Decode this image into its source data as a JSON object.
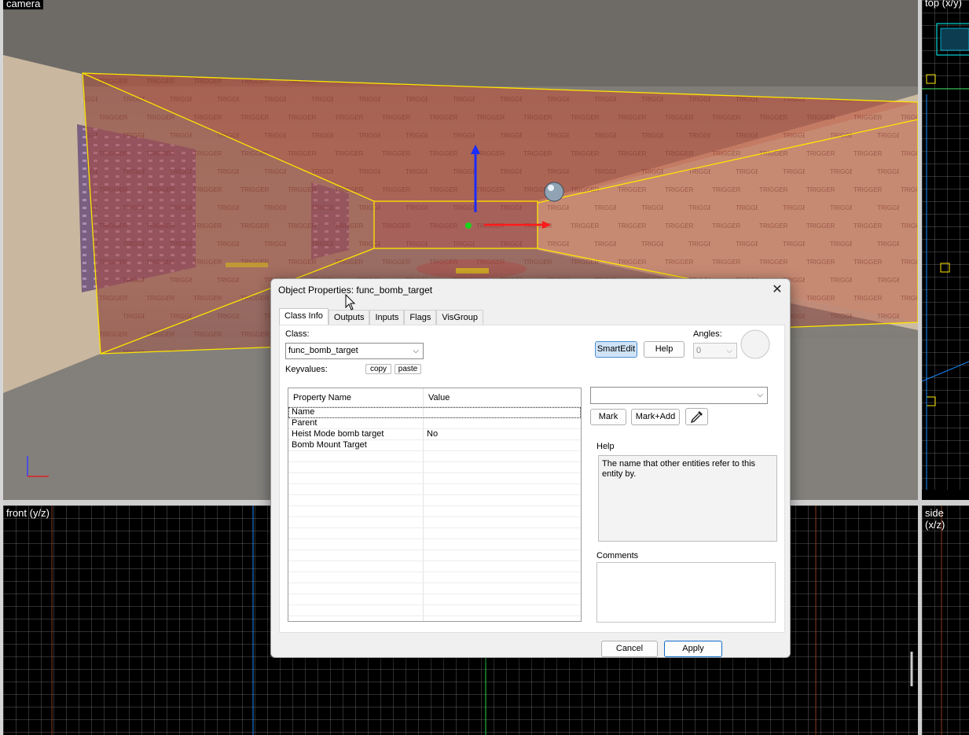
{
  "viewports": {
    "camera_label": "camera",
    "top_label": "top (x/y)",
    "front_label": "front (y/z)",
    "side_label": "side (x/z)"
  },
  "scene": {
    "trigger_text": "TRIGGER"
  },
  "dialog": {
    "title": "Object Properties: func_bomb_target",
    "tabs": [
      {
        "label": "Class Info",
        "active": true
      },
      {
        "label": "Outputs"
      },
      {
        "label": "Inputs"
      },
      {
        "label": "Flags"
      },
      {
        "label": "VisGroup"
      }
    ],
    "class_label": "Class:",
    "class_value": "func_bomb_target",
    "keyvalues_label": "Keyvalues:",
    "copy_label": "copy",
    "paste_label": "paste",
    "smartedit_label": "SmartEdit",
    "help_button_label": "Help",
    "angles_label": "Angles:",
    "angles_value": "0",
    "table": {
      "col_name": "Property Name",
      "col_value": "Value",
      "rows": [
        {
          "name": "Name",
          "value": ""
        },
        {
          "name": "Parent",
          "value": ""
        },
        {
          "name": "Heist Mode bomb target",
          "value": "No"
        },
        {
          "name": "Bomb Mount Target",
          "value": ""
        }
      ]
    },
    "value_combo": "",
    "mark_label": "Mark",
    "mark_add_label": "Mark+Add",
    "help_section_label": "Help",
    "help_text": "The name that other entities refer to this entity by.",
    "comments_label": "Comments",
    "comments_text": "",
    "cancel_label": "Cancel",
    "apply_label": "Apply"
  },
  "colors": {
    "trigger_fill": "#c0503a",
    "selection_outline": "#ffe600",
    "dialog_bg": "#f0f0f0",
    "accent": "#0f6bc7"
  }
}
